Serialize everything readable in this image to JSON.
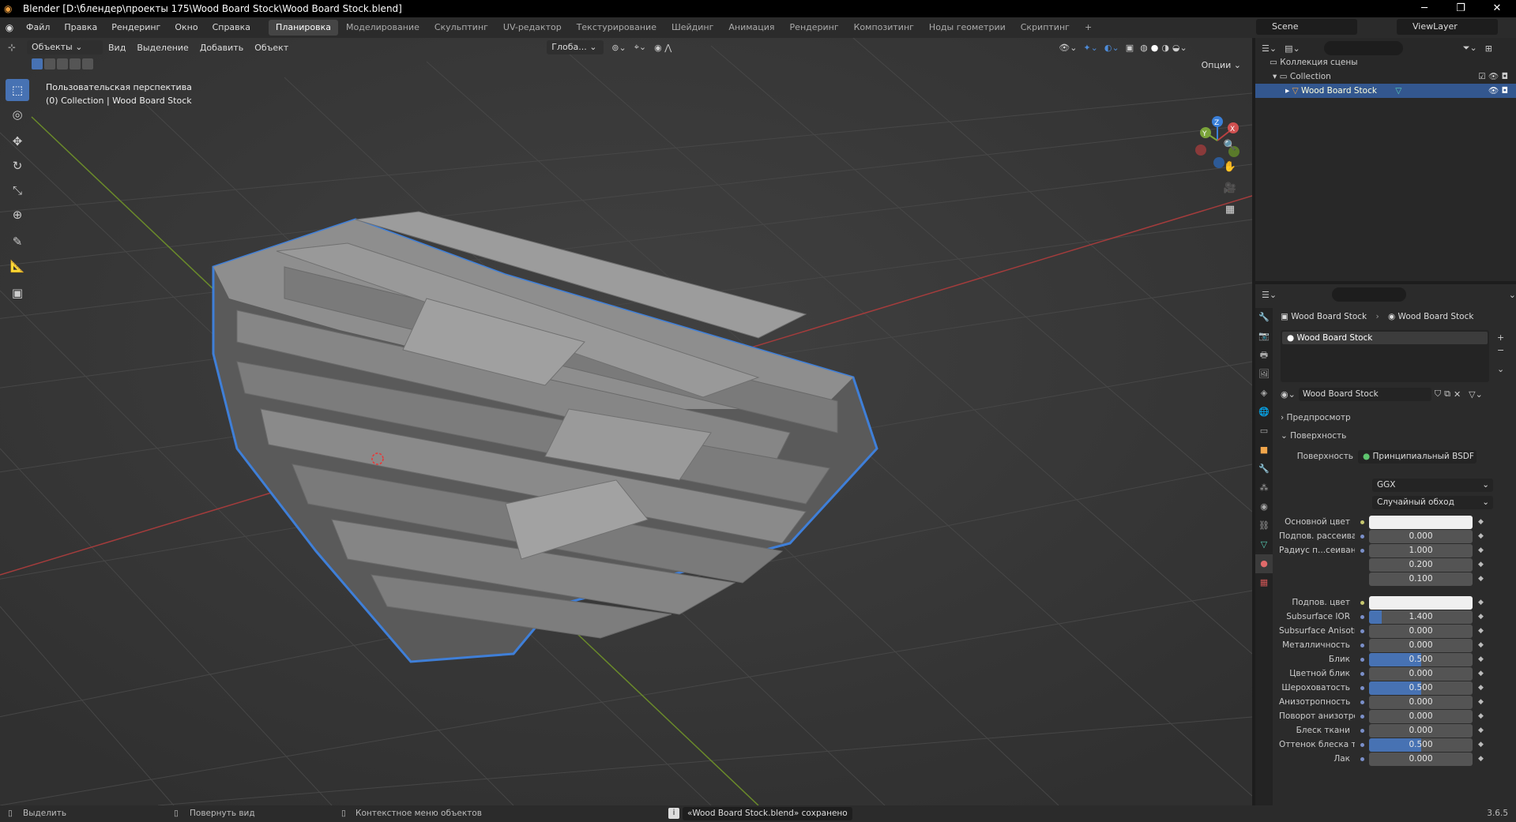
{
  "window": {
    "title": "Blender [D:\\блендер\\проекты 175\\Wood Board Stock\\Wood Board Stock.blend]"
  },
  "menu": [
    "Файл",
    "Правка",
    "Рендеринг",
    "Окно",
    "Справка"
  ],
  "workspaces": [
    "Планировка",
    "Моделирование",
    "Скульптинг",
    "UV-редактор",
    "Текстурирование",
    "Шейдинг",
    "Анимация",
    "Рендеринг",
    "Композитинг",
    "Ноды геометрии",
    "Скриптинг"
  ],
  "workspace_add": "+",
  "scene": "Scene",
  "viewlayer": "ViewLayer",
  "viewport": {
    "mode": "Объекты",
    "menus": [
      "Вид",
      "Выделение",
      "Добавить",
      "Объект"
    ],
    "orientation": "Глоба...",
    "options": "Опции",
    "info_line1": "Пользовательская перспектива",
    "info_line2": "(0) Collection | Wood Board Stock",
    "gizmo": {
      "z": "Z",
      "y": "Y",
      "x": "X"
    }
  },
  "outliner": {
    "root": "Коллекция сцены",
    "collection": "Collection",
    "object": "Wood Board Stock"
  },
  "properties": {
    "breadcrumb_object": "Wood Board Stock",
    "breadcrumb_material": "Wood Board Stock",
    "slot": "Wood Board Stock",
    "material_name": "Wood Board Stock",
    "preview": "Предпросмотр",
    "surface_panel": "Поверхность",
    "surface_label": "Поверхность",
    "surface_value": "Принципиальный BSDF",
    "distribution": "GGX",
    "subsurface_method": "Случайный обход",
    "rows": [
      {
        "label": "Основной цвет",
        "value": "",
        "color": "#f0f0f0",
        "fill": 0
      },
      {
        "label": "Подпов. рассеива...",
        "value": "0.000",
        "fill": 0
      },
      {
        "label": "Радиус п...сеивания",
        "value": "1.000",
        "fill": 0
      },
      {
        "label": "",
        "value": "0.200",
        "fill": 0
      },
      {
        "label": "",
        "value": "0.100",
        "fill": 0
      },
      {
        "label": "Подпов. цвет",
        "value": "",
        "color": "#f0f0f0",
        "fill": 0
      },
      {
        "label": "Subsurface IOR",
        "value": "1.400",
        "fill": 0.12
      },
      {
        "label": "Subsurface Anisotr...",
        "value": "0.000",
        "fill": 0
      },
      {
        "label": "Металличность",
        "value": "0.000",
        "fill": 0
      },
      {
        "label": "Блик",
        "value": "0.500",
        "fill": 0.5
      },
      {
        "label": "Цветной блик",
        "value": "0.000",
        "fill": 0
      },
      {
        "label": "Шероховатость",
        "value": "0.500",
        "fill": 0.5
      },
      {
        "label": "Анизотропность",
        "value": "0.000",
        "fill": 0
      },
      {
        "label": "Поворот анизотро...",
        "value": "0.000",
        "fill": 0
      },
      {
        "label": "Блеск ткани",
        "value": "0.000",
        "fill": 0
      },
      {
        "label": "Оттенок блеска тк...",
        "value": "0.500",
        "fill": 0.5
      },
      {
        "label": "Лак",
        "value": "0.000",
        "fill": 0
      }
    ]
  },
  "status": {
    "select": "Выделить",
    "rotate": "Повернуть вид",
    "context": "Контекстное меню объектов",
    "saved": "«Wood Board Stock.blend» сохранено",
    "version": "3.6.5"
  }
}
